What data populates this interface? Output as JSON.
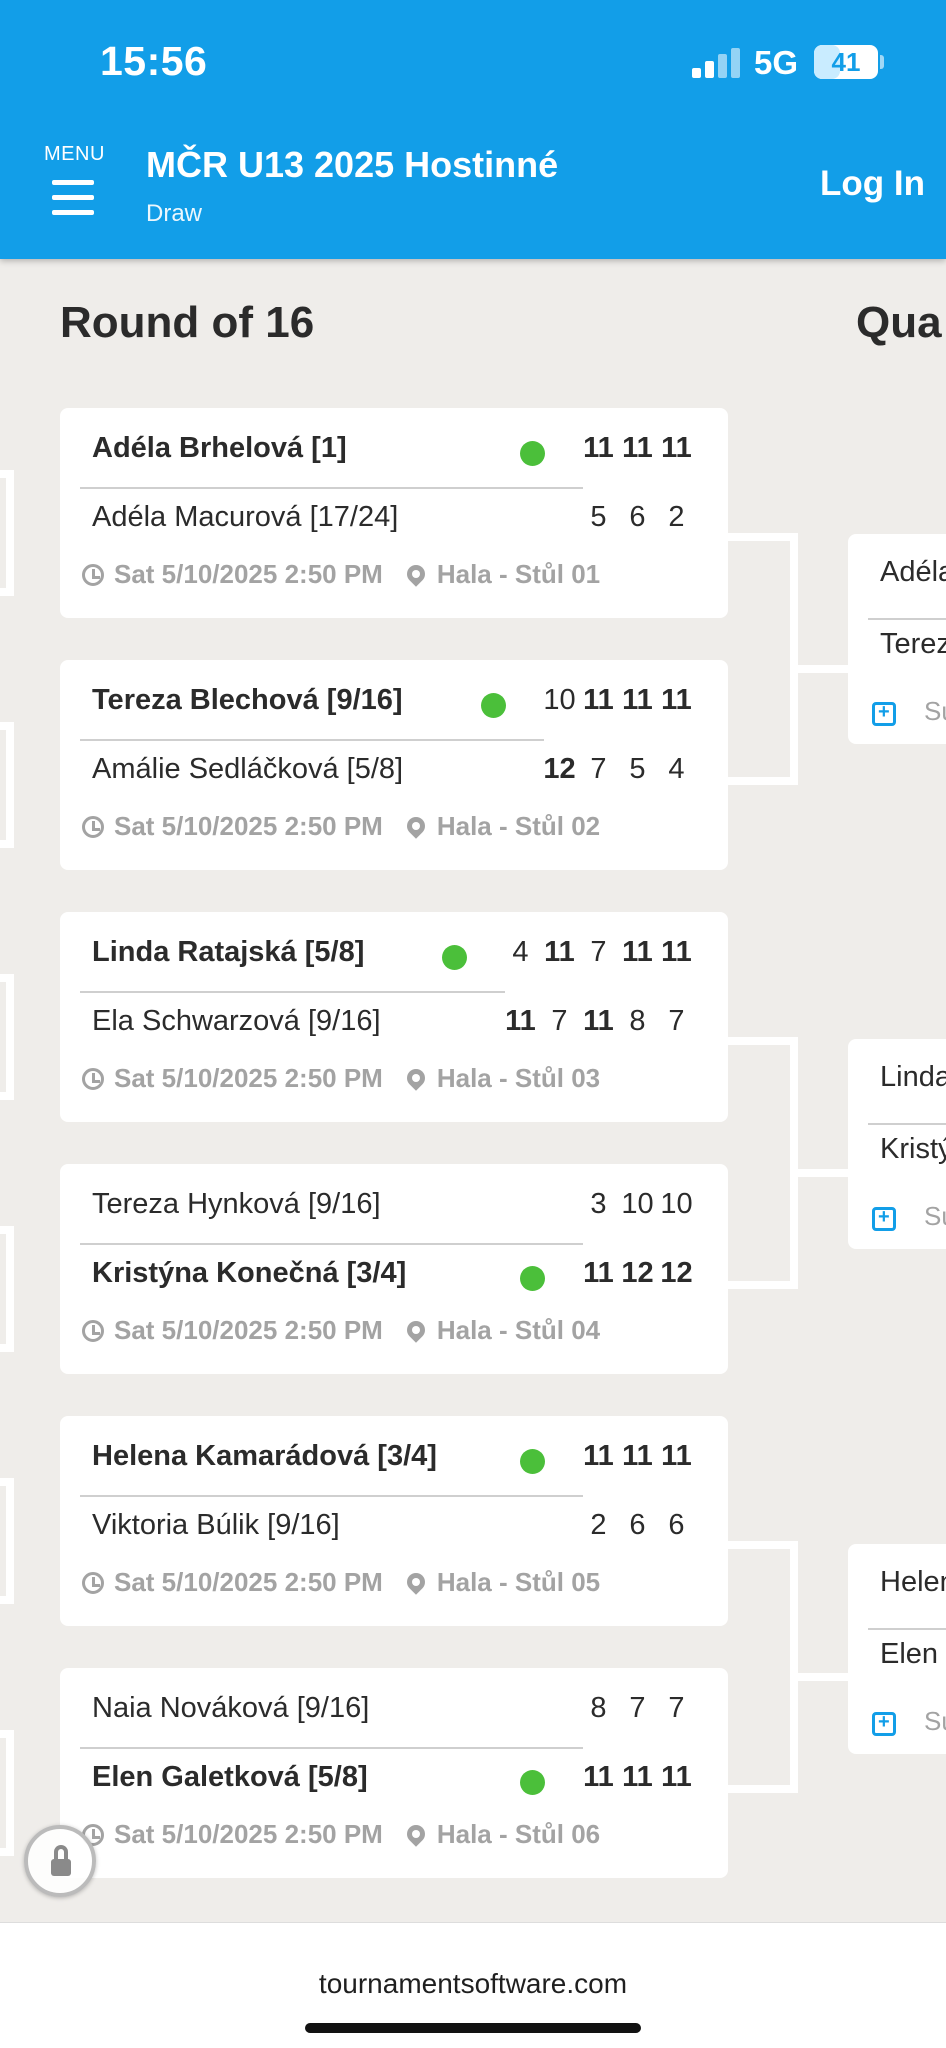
{
  "status_bar": {
    "time": "15:56",
    "network": "5G",
    "battery": "41",
    "battery_fraction": 0.41
  },
  "header": {
    "menu_label": "MENU",
    "title": "MČR U13 2025 Hostinné",
    "subtitle": "Draw",
    "login_label": "Log In"
  },
  "rounds": {
    "round16_title": "Round of 16",
    "quarter_title": "Qua"
  },
  "matches": [
    {
      "p1": {
        "name": "Adéla Brhelová [1]",
        "winner": true,
        "scores": [
          {
            "v": "11",
            "b": true
          },
          {
            "v": "11",
            "b": true
          },
          {
            "v": "11",
            "b": true
          }
        ]
      },
      "p2": {
        "name": "Adéla Macurová [17/24]",
        "winner": false,
        "scores": [
          {
            "v": "5",
            "b": false
          },
          {
            "v": "6",
            "b": false
          },
          {
            "v": "2",
            "b": false
          }
        ]
      },
      "time": "Sat 5/10/2025 2:50 PM",
      "court": "Hala - Stůl 01"
    },
    {
      "p1": {
        "name": "Tereza Blechová [9/16]",
        "winner": true,
        "scores": [
          {
            "v": "10",
            "b": false
          },
          {
            "v": "11",
            "b": true
          },
          {
            "v": "11",
            "b": true
          },
          {
            "v": "11",
            "b": true
          }
        ]
      },
      "p2": {
        "name": "Amálie Sedláčková [5/8]",
        "winner": false,
        "scores": [
          {
            "v": "12",
            "b": true
          },
          {
            "v": "7",
            "b": false
          },
          {
            "v": "5",
            "b": false
          },
          {
            "v": "4",
            "b": false
          }
        ]
      },
      "time": "Sat 5/10/2025 2:50 PM",
      "court": "Hala - Stůl 02"
    },
    {
      "p1": {
        "name": "Linda Ratajská [5/8]",
        "winner": true,
        "scores": [
          {
            "v": "4",
            "b": false
          },
          {
            "v": "11",
            "b": true
          },
          {
            "v": "7",
            "b": false
          },
          {
            "v": "11",
            "b": true
          },
          {
            "v": "11",
            "b": true
          }
        ]
      },
      "p2": {
        "name": "Ela Schwarzová [9/16]",
        "winner": false,
        "scores": [
          {
            "v": "11",
            "b": true
          },
          {
            "v": "7",
            "b": false
          },
          {
            "v": "11",
            "b": true
          },
          {
            "v": "8",
            "b": false
          },
          {
            "v": "7",
            "b": false
          }
        ]
      },
      "time": "Sat 5/10/2025 2:50 PM",
      "court": "Hala - Stůl 03"
    },
    {
      "p1": {
        "name": "Tereza Hynková [9/16]",
        "winner": false,
        "scores": [
          {
            "v": "3",
            "b": false
          },
          {
            "v": "10",
            "b": false
          },
          {
            "v": "10",
            "b": false
          }
        ]
      },
      "p2": {
        "name": "Kristýna Konečná [3/4]",
        "winner": true,
        "scores": [
          {
            "v": "11",
            "b": true
          },
          {
            "v": "12",
            "b": true
          },
          {
            "v": "12",
            "b": true
          }
        ]
      },
      "time": "Sat 5/10/2025 2:50 PM",
      "court": "Hala - Stůl 04"
    },
    {
      "p1": {
        "name": "Helena Kamarádová [3/4]",
        "winner": true,
        "scores": [
          {
            "v": "11",
            "b": true
          },
          {
            "v": "11",
            "b": true
          },
          {
            "v": "11",
            "b": true
          }
        ]
      },
      "p2": {
        "name": "Viktoria Búlik [9/16]",
        "winner": false,
        "scores": [
          {
            "v": "2",
            "b": false
          },
          {
            "v": "6",
            "b": false
          },
          {
            "v": "6",
            "b": false
          }
        ]
      },
      "time": "Sat 5/10/2025 2:50 PM",
      "court": "Hala - Stůl 05"
    },
    {
      "p1": {
        "name": "Naia Nováková [9/16]",
        "winner": false,
        "scores": [
          {
            "v": "8",
            "b": false
          },
          {
            "v": "7",
            "b": false
          },
          {
            "v": "7",
            "b": false
          }
        ]
      },
      "p2": {
        "name": "Elen Galetková [5/8]",
        "winner": true,
        "scores": [
          {
            "v": "11",
            "b": true
          },
          {
            "v": "11",
            "b": true
          },
          {
            "v": "11",
            "b": true
          }
        ]
      },
      "time": "Sat 5/10/2025 2:50 PM",
      "court": "Hala - Stůl 06"
    }
  ],
  "quarterfinals": [
    {
      "p1": "Adéla",
      "p2": "Terez",
      "time": "Su"
    },
    {
      "p1": "Linda",
      "p2": "Kristý",
      "time": "Su"
    },
    {
      "p1": "Helen",
      "p2": "Elen",
      "time": "Su"
    }
  ],
  "footer": {
    "url": "tournamentsoftware.com"
  },
  "colors": {
    "header_bg": "#129ee8",
    "winner_dot": "#4bbf3a",
    "page_bg": "#efedea"
  }
}
